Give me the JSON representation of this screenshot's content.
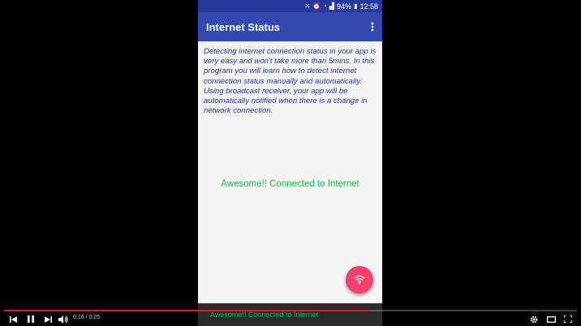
{
  "status_bar": {
    "battery": "94%",
    "time": "12:58"
  },
  "app_bar": {
    "title": "Internet Status",
    "menu_icon": "more-vert-icon"
  },
  "content": {
    "description": "Detecting internet connection status in your app is very easy and won't take more than 5mins. In this program you will learn how to detect internet connection status manually and automatically. Using broadcast receiver, your app will be automatically notified when there is a change in network connection.",
    "connection_status": "Awesome!! Connected to Internet"
  },
  "fab": {
    "icon": "wifi-icon",
    "color": "#f2426c"
  },
  "snackbar": {
    "text": "Awesome!! Connected to Internet"
  },
  "video": {
    "current_time": "0:16",
    "duration": "0:25",
    "time_text": "0:16 / 0:25",
    "progress": 0.64,
    "accent": "#e01e1e"
  },
  "colors": {
    "primary": "#3349b0",
    "primary_dark": "#27399a",
    "success": "#19b84a",
    "text_primary": "#23349c"
  }
}
